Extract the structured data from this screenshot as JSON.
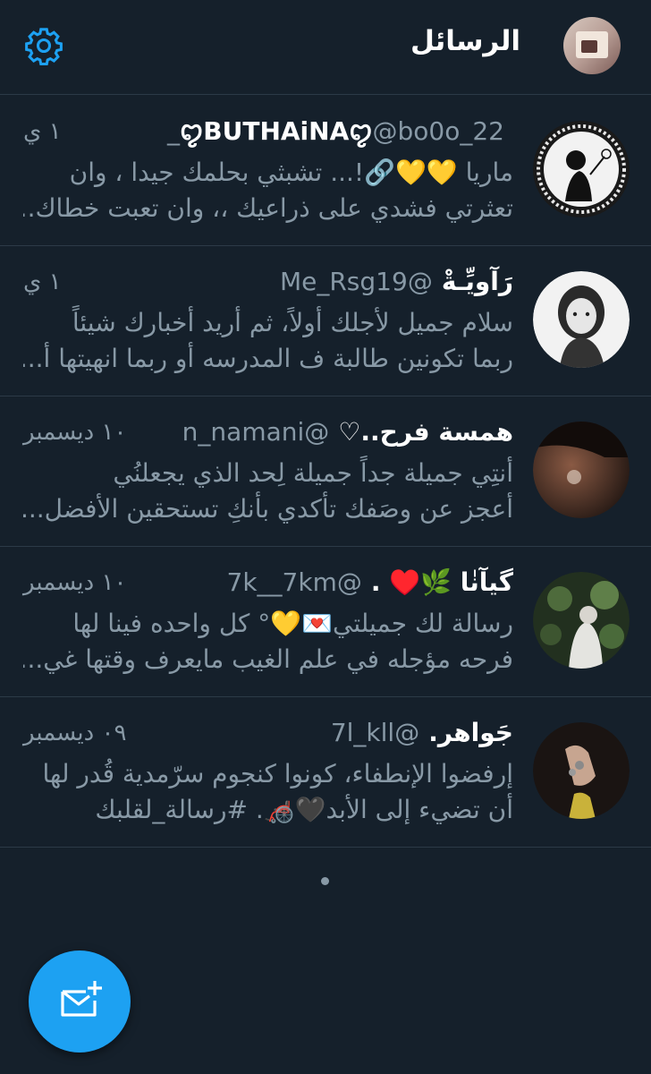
{
  "header": {
    "title": "الرسائل",
    "settings_icon": "gear-icon",
    "accent_color": "#1da1f2"
  },
  "conversations": [
    {
      "name": "ꨄ︎BUTHAiNAꨄ︎",
      "handle": "@bo0o_22_",
      "time": "١ ي",
      "preview_line1": "ماريا 💛💛🔗!... تشبثي بحلمك جيدا ، وان",
      "preview_line2": "تعثرتي فشدي على ذراعيك ،، وان تعبت خطاك...❤️"
    },
    {
      "name": "رَآويِّـةْ",
      "handle": "@Me_Rsg19",
      "time": "١ ي",
      "preview_line1": "سلام جميل لأجلك أولاً، ثم أريد أخبارك شيئاً",
      "preview_line2": "ربما تكونين طالبة ف المدرسه أو ربما انهيتها أ...❤️"
    },
    {
      "name": "همسة فرح..♡",
      "handle": "@n_namani",
      "time": "١٠ ديسمبر",
      "preview_line1": "أنتِي جميلة جداً جميلة لِحد الذي يجعلنُي",
      "preview_line2": "أعجز عن وصَفك تأكدي بأنكِ تستحقين الأفضل..."
    },
    {
      "name": "گيآنٰا 🌿♥️ .",
      "handle": "@7k__7km",
      "time": "١٠ ديسمبر",
      "preview_line1": "رسالة لك جميلتي💌💛° كل واحده فينا لها",
      "preview_line2": "فرحه مؤجله في علم الغيب مايعرف وقتها غي..."
    },
    {
      "name": "جَواهر.",
      "handle": "@7l_kll",
      "time": "٠٩ ديسمبر",
      "preview_line1": "إرفضوا الإنطفاء، كونوا كنجوم سرّمدية قُدر لها",
      "preview_line2": "أن تضيء إلى الأبد🖤🦽. #رسالة_لقلبك"
    }
  ],
  "compose_button": {
    "icon": "new-message-icon",
    "color": "#1da1f2"
  }
}
